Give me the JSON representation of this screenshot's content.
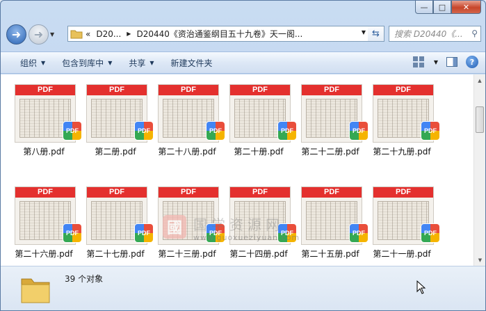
{
  "window": {
    "caption_buttons": {
      "minimize": "—",
      "maximize": "□",
      "close": "✕"
    }
  },
  "nav": {
    "back_icon": "back-arrow-icon",
    "forward_icon": "forward-arrow-icon",
    "address": {
      "prefix": "«",
      "crumb1": "D20...",
      "crumb2": "D20440《资治通鉴纲目五十九卷》天一阁..."
    },
    "search_placeholder": "搜索 D20440《..."
  },
  "toolbar": {
    "organize": "组织",
    "include_in_library": "包含到库中",
    "share": "共享",
    "new_folder": "新建文件夹"
  },
  "files": [
    {
      "name": "第八册.pdf",
      "banner": "PDF",
      "badge": "PDF"
    },
    {
      "name": "第二册.pdf",
      "banner": "PDF",
      "badge": "PDF"
    },
    {
      "name": "第二十八册.pdf",
      "banner": "PDF",
      "badge": "PDF"
    },
    {
      "name": "第二十册.pdf",
      "banner": "PDF",
      "badge": "PDF"
    },
    {
      "name": "第二十二册.pdf",
      "banner": "PDF",
      "badge": "PDF"
    },
    {
      "name": "第二十九册.pdf",
      "banner": "PDF",
      "badge": "PDF"
    },
    {
      "name": "第二十六册.pdf",
      "banner": "PDF",
      "badge": "PDF"
    },
    {
      "name": "第二十七册.pdf",
      "banner": "PDF",
      "badge": "PDF"
    },
    {
      "name": "第二十三册.pdf",
      "banner": "PDF",
      "badge": "PDF"
    },
    {
      "name": "第二十四册.pdf",
      "banner": "PDF",
      "badge": "PDF"
    },
    {
      "name": "第二十五册.pdf",
      "banner": "PDF",
      "badge": "PDF"
    },
    {
      "name": "第二十一册.pdf",
      "banner": "PDF",
      "badge": "PDF"
    }
  ],
  "watermark": {
    "logo_char": "國",
    "text": "国学资源网",
    "url": "www.guoxueziyuan.com"
  },
  "status": {
    "item_count": "39 个对象"
  }
}
